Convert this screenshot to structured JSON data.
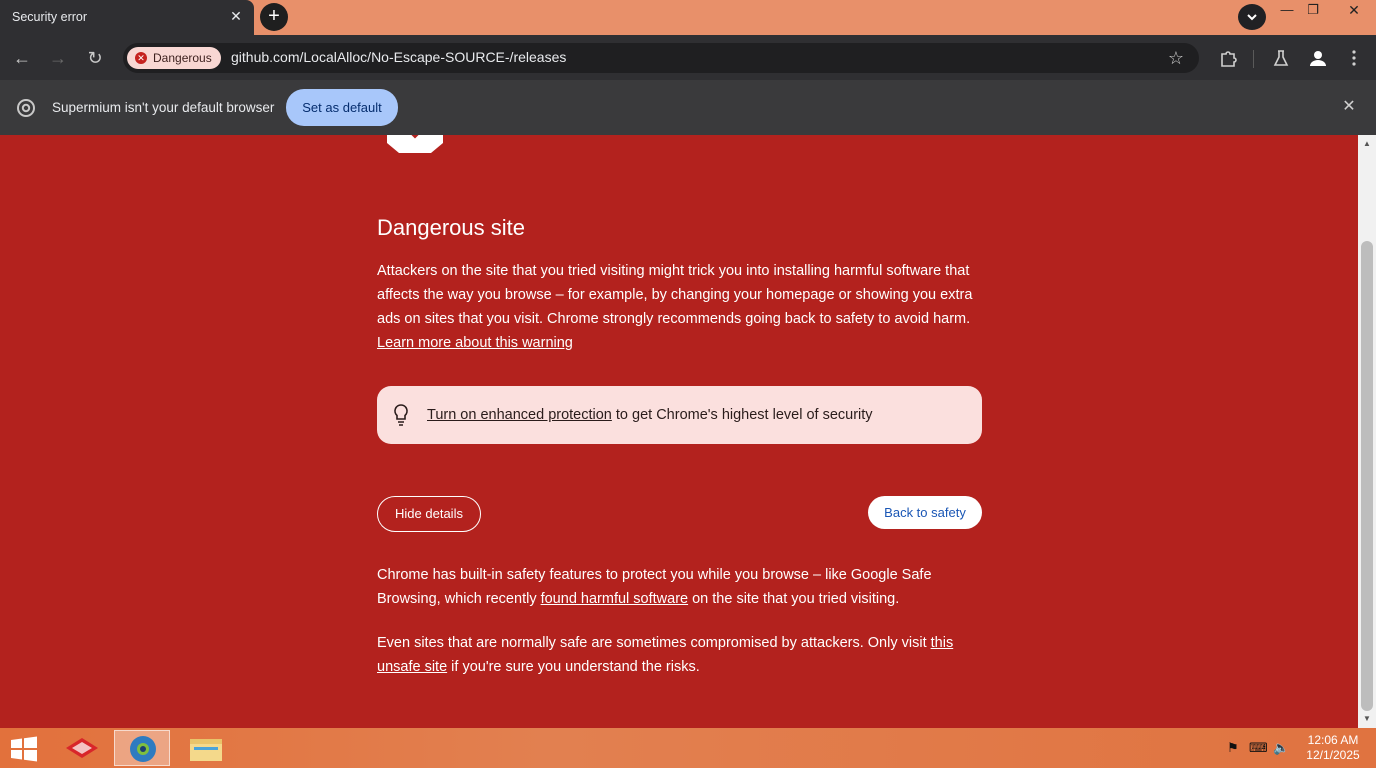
{
  "tab": {
    "title": "Security error",
    "close": "✕",
    "new_tab": "+"
  },
  "window_controls": {
    "tab_search": "⌄",
    "minimize": "—",
    "restore": "❐",
    "close": "✕"
  },
  "toolbar": {
    "back": "←",
    "forward": "→",
    "reload": "↻",
    "security_chip": "Dangerous",
    "url": "github.com/LocalAlloc/No-Escape-SOURCE-/releases",
    "bookmark": "☆"
  },
  "infobar": {
    "message": "Supermium isn't your default browser",
    "button": "Set as default",
    "close": "✕"
  },
  "page": {
    "heading": "Dangerous site",
    "intro": "Attackers on the site that you tried visiting might trick you into installing harmful software that affects the way you browse – for example, by changing your homepage or showing you extra ads on sites that you visit. Chrome strongly recommends going back to safety to avoid harm.",
    "learn_more": "Learn more about this warning",
    "protection_link": "Turn on enhanced protection",
    "protection_text": " to get Chrome's highest level of security",
    "hide_details": "Hide details",
    "back_to_safety": "Back to safety",
    "details_1_a": "Chrome has built-in safety features to protect you while you browse – like Google Safe Browsing, which recently ",
    "details_1_link": "found harmful software",
    "details_1_b": " on the site that you tried visiting.",
    "details_2_a": "Even sites that are normally safe are sometimes compromised by attackers. Only visit ",
    "details_2_link": "this unsafe site",
    "details_2_b": " if you're sure you understand the risks."
  },
  "taskbar": {
    "time": "12:06 AM",
    "date": "12/1/2025"
  },
  "colors": {
    "danger_bg": "#b3221e",
    "chip_bg": "#f8d7d3",
    "set_default_bg": "#a8c7fa",
    "back_to_safety_text": "#1a56b5"
  }
}
